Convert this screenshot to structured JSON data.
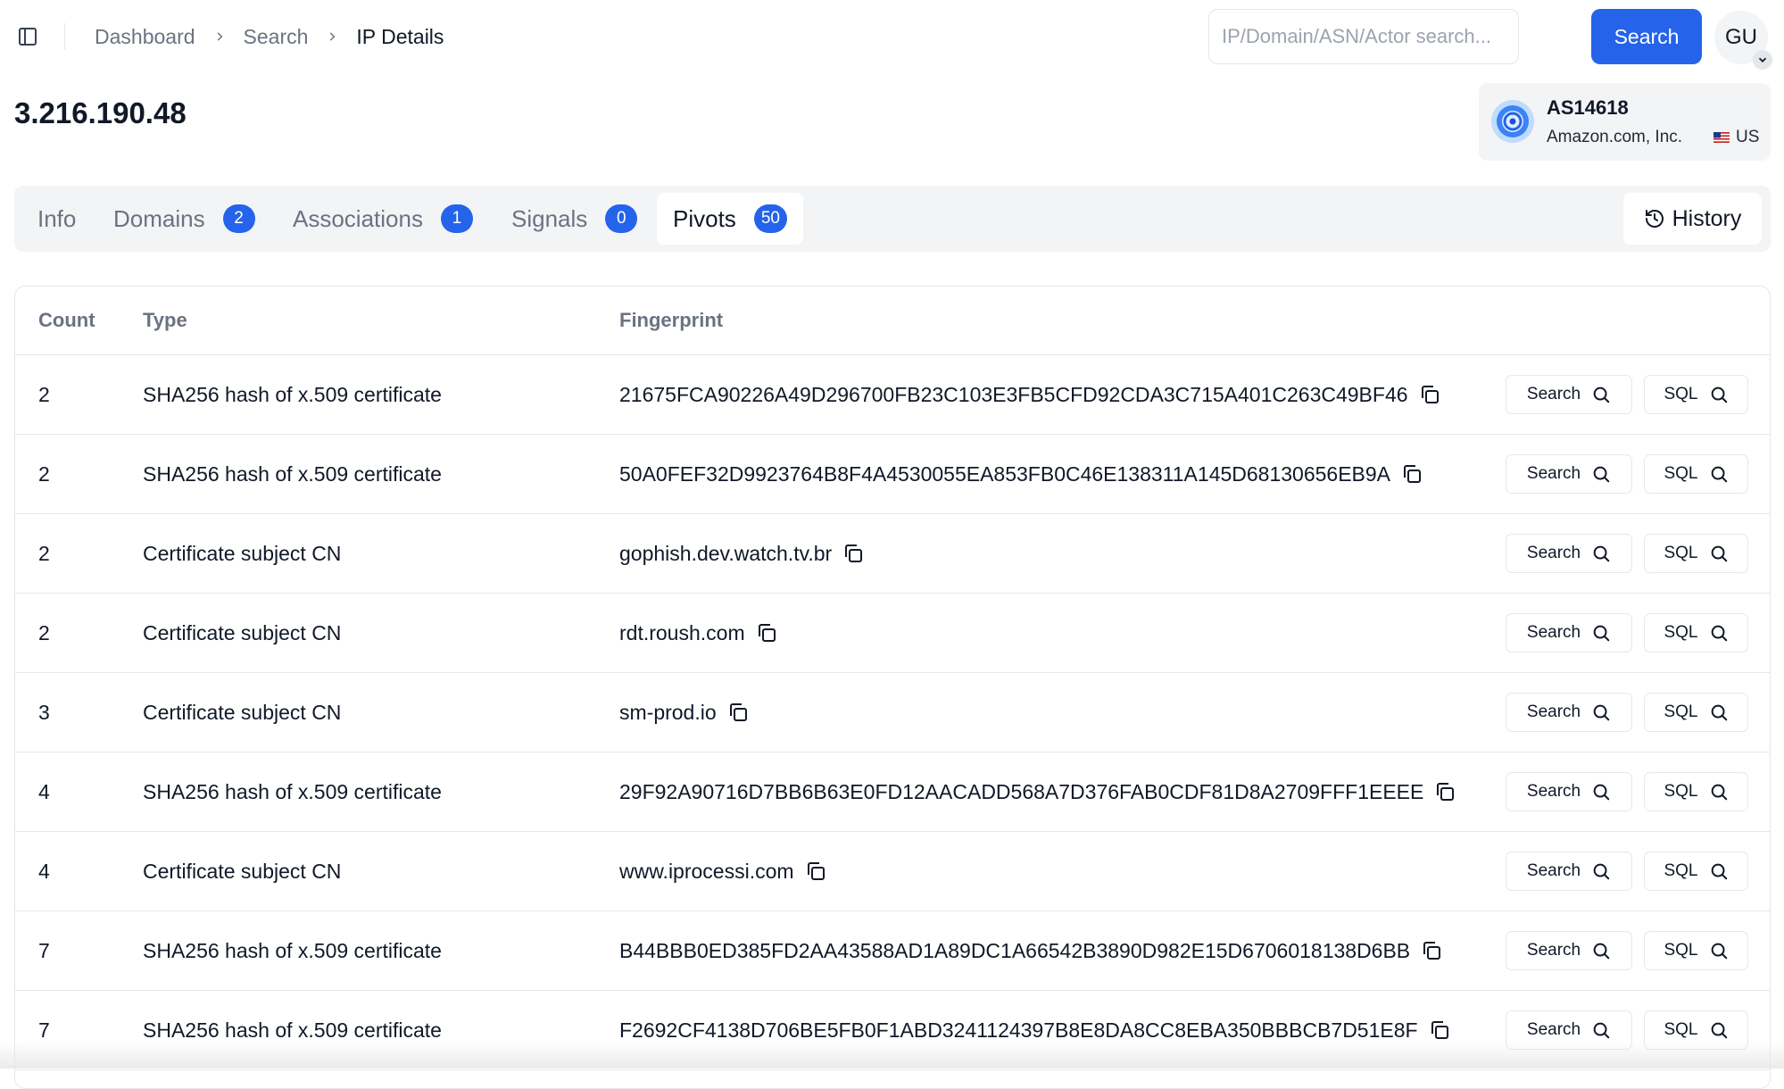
{
  "breadcrumb": [
    "Dashboard",
    "Search",
    "IP Details"
  ],
  "search": {
    "placeholder": "IP/Domain/ASN/Actor search...",
    "button_label": "Search"
  },
  "user": {
    "initials": "GU"
  },
  "ip": "3.216.190.48",
  "asn": {
    "number": "AS14618",
    "org": "Amazon.com, Inc.",
    "country": "US"
  },
  "tabs": [
    {
      "label": "Info"
    },
    {
      "label": "Domains",
      "count": "2"
    },
    {
      "label": "Associations",
      "count": "1"
    },
    {
      "label": "Signals",
      "count": "0"
    },
    {
      "label": "Pivots",
      "count": "50"
    }
  ],
  "history_label": "History",
  "table": {
    "headers": {
      "count": "Count",
      "type": "Type",
      "fingerprint": "Fingerprint"
    },
    "action_labels": {
      "search": "Search",
      "sql": "SQL"
    },
    "rows": [
      {
        "count": "2",
        "type": "SHA256 hash of x.509 certificate",
        "fingerprint": "21675FCA90226A49D296700FB23C103E3FB5CFD92CDA3C715A401C263C49BF46"
      },
      {
        "count": "2",
        "type": "SHA256 hash of x.509 certificate",
        "fingerprint": "50A0FEF32D9923764B8F4A4530055EA853FB0C46E138311A145D68130656EB9A"
      },
      {
        "count": "2",
        "type": "Certificate subject CN",
        "fingerprint": "gophish.dev.watch.tv.br"
      },
      {
        "count": "2",
        "type": "Certificate subject CN",
        "fingerprint": "rdt.roush.com"
      },
      {
        "count": "3",
        "type": "Certificate subject CN",
        "fingerprint": "sm-prod.io"
      },
      {
        "count": "4",
        "type": "SHA256 hash of x.509 certificate",
        "fingerprint": "29F92A90716D7BB6B63E0FD12AACADD568A7D376FAB0CDF81D8A2709FFF1EEEE"
      },
      {
        "count": "4",
        "type": "Certificate subject CN",
        "fingerprint": "www.iprocessi.com"
      },
      {
        "count": "7",
        "type": "SHA256 hash of x.509 certificate",
        "fingerprint": "B44BBB0ED385FD2AA43588AD1A89DC1A66542B3890D982E15D6706018138D6BB"
      },
      {
        "count": "7",
        "type": "SHA256 hash of x.509 certificate",
        "fingerprint": "F2692CF4138D706BE5FB0F1ABD3241124397B8E8DA8CC8EBA350BBBCB7D51E8F"
      }
    ]
  }
}
